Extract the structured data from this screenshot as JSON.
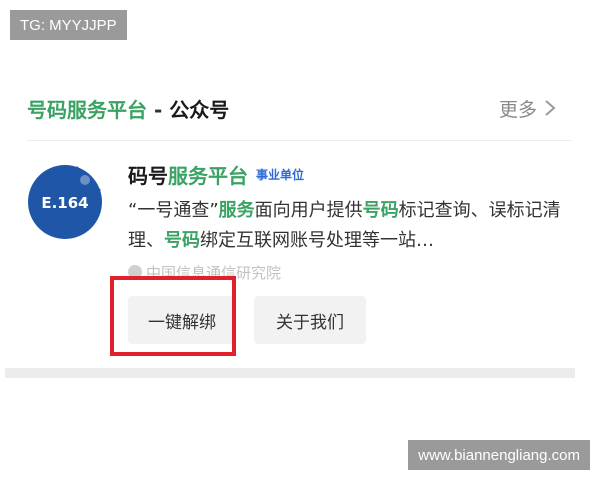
{
  "watermarks": {
    "top_left": "TG: MYYJJPP",
    "bottom_right": "www.biannengliang.com"
  },
  "section": {
    "title_brand": "号码服务平台",
    "title_separator": " - ",
    "title_suffix": "公众号",
    "more_label": "更多",
    "more_icon": "chevron-right-icon"
  },
  "account": {
    "logo_text": "E.164",
    "logo_color": "#1f56a8",
    "name_plain": "码号",
    "name_green": "服务平台",
    "badge": "事业单位",
    "description": {
      "p1": "“一号通查”",
      "g1": "服务",
      "p2": "面向用户提供",
      "g2": "号码",
      "p3": "标记查询、误标记清理、",
      "g3": "号码",
      "p4": "绑定互联网账号处理等一站…"
    },
    "organization": "中国信息通信研究院"
  },
  "buttons": {
    "unbind": "一键解绑",
    "about": "关于我们"
  },
  "colors": {
    "brand_green": "#3aa363",
    "badge_blue": "#2f6bd8",
    "highlight_red": "#e0202a"
  }
}
